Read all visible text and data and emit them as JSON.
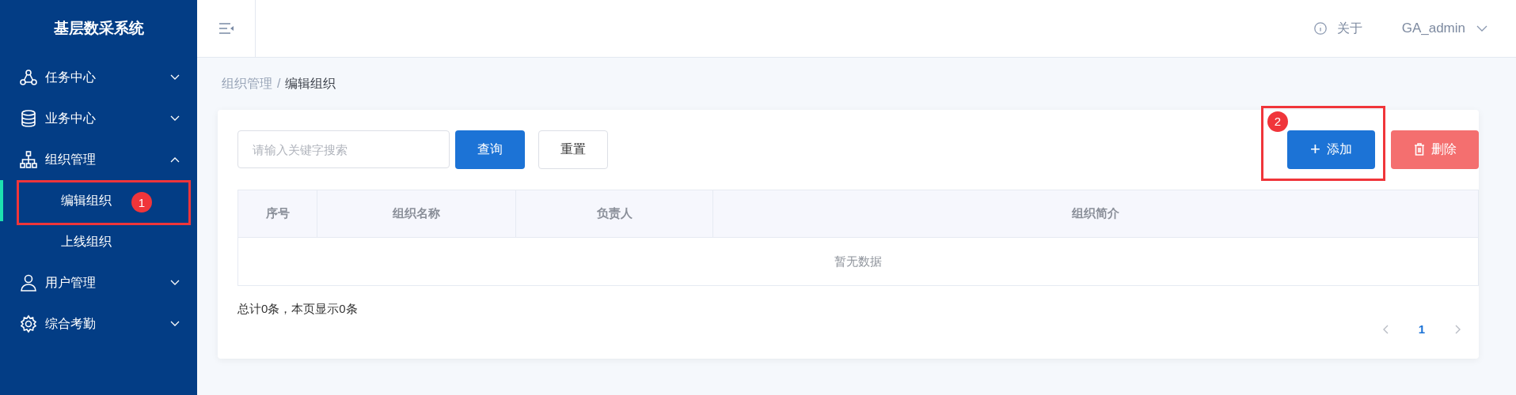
{
  "sidebar": {
    "title": "基层数采系统",
    "items": [
      {
        "label": "任务中心",
        "expanded": false
      },
      {
        "label": "业务中心",
        "expanded": false
      },
      {
        "label": "组织管理",
        "expanded": true,
        "children": [
          {
            "label": "编辑组织",
            "selected": true,
            "annotation": "1"
          },
          {
            "label": "上线组织",
            "selected": false
          }
        ]
      },
      {
        "label": "用户管理",
        "expanded": false
      },
      {
        "label": "综合考勤",
        "expanded": false
      }
    ]
  },
  "header": {
    "about": "关于",
    "user": "GA_admin"
  },
  "breadcrumb": [
    {
      "label": "组织管理",
      "current": false
    },
    {
      "label": "编辑组织",
      "current": true
    }
  ],
  "breadcrumb_separator": "/",
  "toolbar": {
    "search": {
      "placeholder": "请输入关键字搜索"
    },
    "query_button": "查询",
    "reset_button": "重置",
    "add_button": {
      "icon": "+",
      "label": "添加",
      "annotation": "2"
    },
    "delete_button": "删除"
  },
  "table": {
    "columns": [
      "序号",
      "组织名称",
      "负责人",
      "组织简介"
    ],
    "empty_text": "暂无数据"
  },
  "footer": {
    "summary": "总计0条，本页显示0条",
    "pages": [
      {
        "label": "1",
        "selected": true
      }
    ]
  }
}
